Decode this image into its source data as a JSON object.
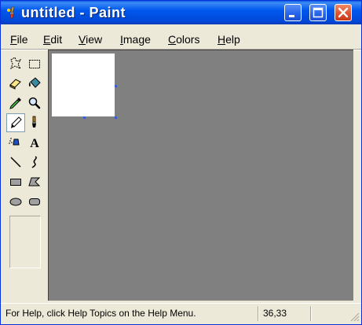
{
  "window": {
    "title": "untitled - Paint",
    "app_icon": "paint-brush-icon",
    "controls": [
      "minimize-icon",
      "maximize-icon",
      "close-icon"
    ]
  },
  "menu": {
    "items": [
      {
        "label": "File",
        "accel": "F",
        "rest": "ile"
      },
      {
        "label": "Edit",
        "accel": "E",
        "rest": "dit"
      },
      {
        "label": "View",
        "accel": "V",
        "rest": "iew"
      },
      {
        "label": "Image",
        "accel": "I",
        "rest": "mage"
      },
      {
        "label": "Colors",
        "accel": "C",
        "rest": "olors"
      },
      {
        "label": "Help",
        "accel": "H",
        "rest": "elp"
      }
    ]
  },
  "toolbox": {
    "tools": [
      {
        "name": "free-form-select",
        "icon": "free-form-select-icon"
      },
      {
        "name": "select",
        "icon": "rectangle-select-icon"
      },
      {
        "name": "eraser",
        "icon": "eraser-icon"
      },
      {
        "name": "fill-with-color",
        "icon": "paint-bucket-icon"
      },
      {
        "name": "pick-color",
        "icon": "eyedropper-icon"
      },
      {
        "name": "magnifier",
        "icon": "magnifier-icon"
      },
      {
        "name": "pencil",
        "icon": "pencil-icon",
        "selected": true
      },
      {
        "name": "brush",
        "icon": "brush-icon"
      },
      {
        "name": "airbrush",
        "icon": "airbrush-icon"
      },
      {
        "name": "text",
        "icon": "text-icon",
        "glyph": "A"
      },
      {
        "name": "line",
        "icon": "line-icon"
      },
      {
        "name": "curve",
        "icon": "curve-icon"
      },
      {
        "name": "rectangle",
        "icon": "rectangle-icon"
      },
      {
        "name": "polygon",
        "icon": "polygon-icon"
      },
      {
        "name": "ellipse",
        "icon": "ellipse-icon"
      },
      {
        "name": "rounded-rectangle",
        "icon": "rounded-rectangle-icon"
      }
    ]
  },
  "status": {
    "help_text": "For Help, click Help Topics on the Help Menu.",
    "coordinates": "36,33"
  },
  "colors": {
    "title_bar": "#0054e3",
    "workspace": "#808080",
    "canvas": "#ffffff",
    "chrome": "#ece9d8",
    "close_button": "#e0532b"
  }
}
